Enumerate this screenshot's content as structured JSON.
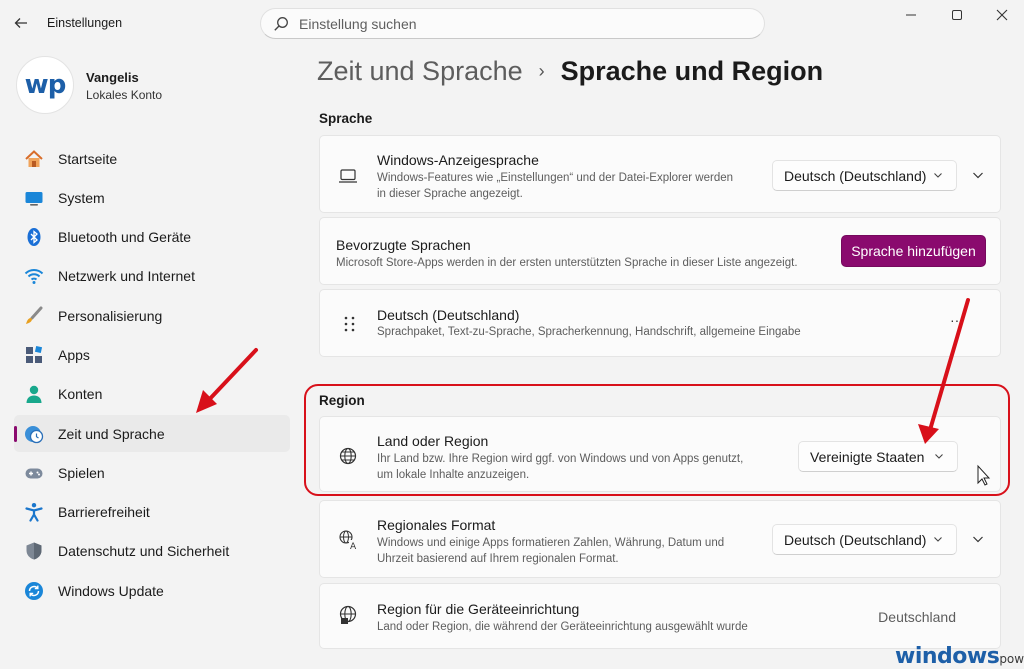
{
  "window": {
    "title": "Einstellungen",
    "search_placeholder": "Einstellung suchen",
    "controls": {
      "minimize": "—",
      "maximize": "☐",
      "close": "✕"
    }
  },
  "profile": {
    "avatar_text": "wp",
    "name": "Vangelis",
    "account_type": "Lokales Konto"
  },
  "sidebar": {
    "items": [
      {
        "label": "Startseite",
        "icon": "home-icon",
        "active": false
      },
      {
        "label": "System",
        "icon": "monitor-icon",
        "active": false
      },
      {
        "label": "Bluetooth und Geräte",
        "icon": "bluetooth-icon",
        "active": false
      },
      {
        "label": "Netzwerk und Internet",
        "icon": "wifi-icon",
        "active": false
      },
      {
        "label": "Personalisierung",
        "icon": "brush-icon",
        "active": false
      },
      {
        "label": "Apps",
        "icon": "apps-icon",
        "active": false
      },
      {
        "label": "Konten",
        "icon": "account-icon",
        "active": false
      },
      {
        "label": "Zeit und Sprache",
        "icon": "clock-globe-icon",
        "active": true
      },
      {
        "label": "Spielen",
        "icon": "gamepad-icon",
        "active": false
      },
      {
        "label": "Barrierefreiheit",
        "icon": "accessibility-icon",
        "active": false
      },
      {
        "label": "Datenschutz und Sicherheit",
        "icon": "shield-icon",
        "active": false
      },
      {
        "label": "Windows Update",
        "icon": "update-icon",
        "active": false
      }
    ]
  },
  "breadcrumb": {
    "parent": "Zeit und Sprache",
    "separator": "›",
    "current": "Sprache und Region"
  },
  "sections": {
    "sprache": {
      "label": "Sprache",
      "display_language": {
        "title": "Windows-Anzeigesprache",
        "description_line1": "Windows-Features wie „Einstellungen“ und der Datei-Explorer werden",
        "description_line2": "in dieser Sprache angezeigt.",
        "value": "Deutsch (Deutschland)"
      },
      "preferred_languages": {
        "title": "Bevorzugte Sprachen",
        "description": "Microsoft Store-Apps werden in der ersten unterstützten Sprache in dieser Liste angezeigt.",
        "button": "Sprache hinzufügen"
      },
      "language_entry": {
        "title": "Deutsch (Deutschland)",
        "description": "Sprachpaket, Text-zu-Sprache, Spracherkennung, Handschrift, allgemeine Eingabe",
        "more": "···"
      }
    },
    "region": {
      "label": "Region",
      "country": {
        "title": "Land oder Region",
        "description_line1": "Ihr Land bzw. Ihre Region wird ggf. von Windows und von Apps genutzt,",
        "description_line2": "um lokale Inhalte anzuzeigen.",
        "value": "Vereinigte Staaten"
      },
      "regional_format": {
        "title": "Regionales Format",
        "description_line1": "Windows und einige Apps formatieren Zahlen, Währung, Datum und",
        "description_line2": "Uhrzeit basierend auf Ihrem regionalen Format.",
        "value": "Deutsch (Deutschland)"
      },
      "device_setup_region": {
        "title": "Region für die Geräteeinrichtung",
        "description": "Land oder Region, die während der Geräteeinrichtung ausgewählt wurde",
        "value": "Deutschland"
      }
    }
  },
  "watermark": {
    "brand": "windows",
    "suffix": "power"
  },
  "colors": {
    "accent": "#8a0a6e",
    "annotation": "#d8101a",
    "brand": "#1d5fa8"
  }
}
